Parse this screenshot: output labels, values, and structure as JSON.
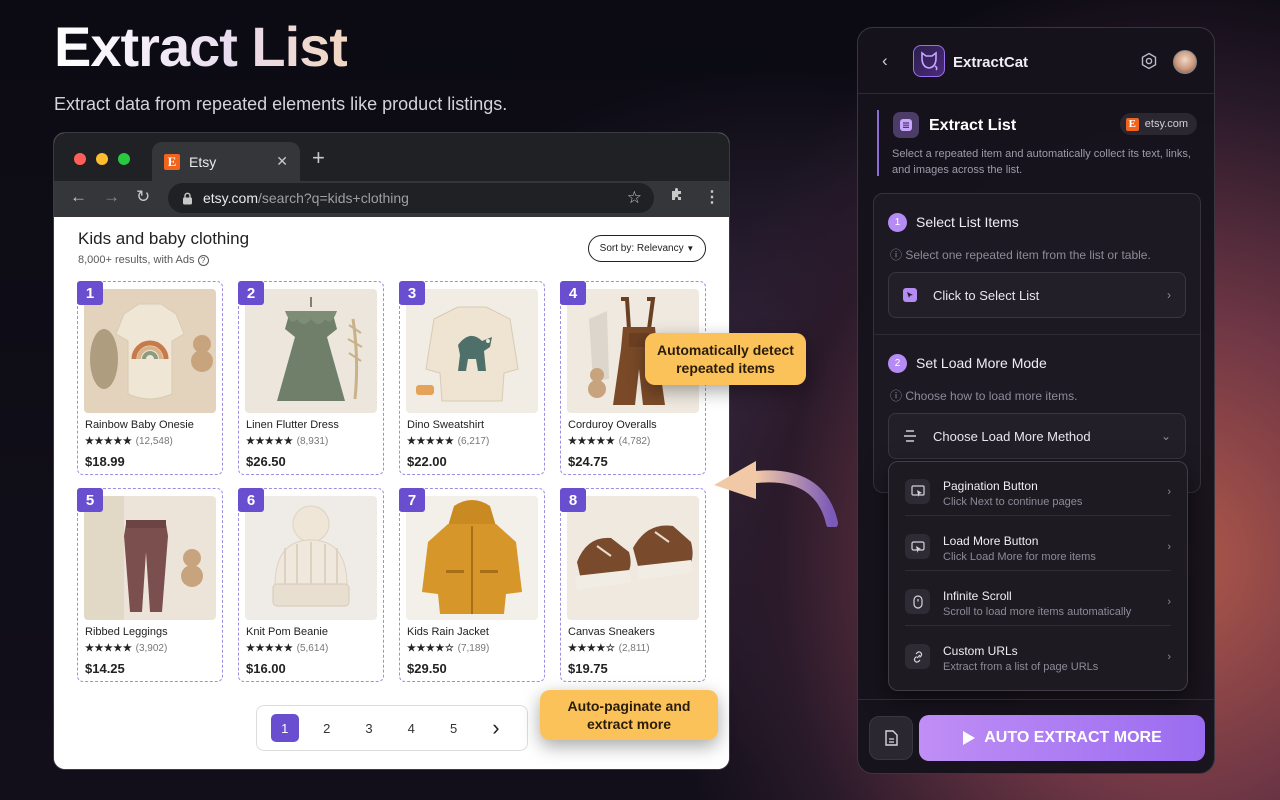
{
  "hero": {
    "title": "Extract List",
    "subtitle": "Extract data from repeated elements like product listings."
  },
  "browser": {
    "tab_title": "Etsy",
    "tab_close": "✕",
    "new_tab": "+",
    "url_domain": "etsy.com",
    "url_path": "/search?q=kids+clothing",
    "page_title": "Kids and baby clothing",
    "results": "8,000+ results, with Ads",
    "sort_label": "Sort by: Relevancy",
    "products": [
      {
        "badge": "1",
        "name": "Rainbow Baby Onesie",
        "stars": "★★★★★",
        "reviews": "(12,548)",
        "price": "$18.99"
      },
      {
        "badge": "2",
        "name": "Linen Flutter Dress",
        "stars": "★★★★★",
        "reviews": "(8,931)",
        "price": "$26.50"
      },
      {
        "badge": "3",
        "name": "Dino Sweatshirt",
        "stars": "★★★★★",
        "reviews": "(6,217)",
        "price": "$22.00"
      },
      {
        "badge": "4",
        "name": "Corduroy Overalls",
        "stars": "★★★★★",
        "reviews": "(4,782)",
        "price": "$24.75"
      },
      {
        "badge": "5",
        "name": "Ribbed Leggings",
        "stars": "★★★★★",
        "reviews": "(3,902)",
        "price": "$14.25"
      },
      {
        "badge": "6",
        "name": "Knit Pom Beanie",
        "stars": "★★★★★",
        "reviews": "(5,614)",
        "price": "$16.00"
      },
      {
        "badge": "7",
        "name": "Kids Rain Jacket",
        "stars": "★★★★☆",
        "reviews": "(7,189)",
        "price": "$29.50"
      },
      {
        "badge": "8",
        "name": "Canvas Sneakers",
        "stars": "★★★★☆",
        "reviews": "(2,811)",
        "price": "$19.75"
      }
    ],
    "pages": [
      "1",
      "2",
      "3",
      "4",
      "5"
    ],
    "next": "›"
  },
  "callouts": {
    "detect_line1": "Automatically detect",
    "detect_line2": "repeated items",
    "paginate_line1": "Auto-paginate and",
    "paginate_line2": "extract more"
  },
  "panel": {
    "brand": "ExtractCat",
    "section_title": "Extract List",
    "site": "etsy.com",
    "section_desc": "Select a repeated item and automatically collect its text, links, and images across the list.",
    "step1": {
      "num": "1",
      "title": "Select List Items",
      "hint": "ⓘ Select one repeated item from the list or table.",
      "button": "Click to Select List"
    },
    "step2": {
      "num": "2",
      "title": "Set Load More Mode",
      "hint": "ⓘ Choose how to load more items.",
      "button": "Choose Load More Method"
    },
    "options": [
      {
        "title": "Pagination Button",
        "desc": "Click Next to continue pages"
      },
      {
        "title": "Load More Button",
        "desc": "Click Load More for more items"
      },
      {
        "title": "Infinite Scroll",
        "desc": "Scroll to load more items automatically"
      },
      {
        "title": "Custom URLs",
        "desc": "Extract from a list of page URLs"
      }
    ],
    "cta": "AUTO EXTRACT MORE"
  },
  "colors": {
    "accent": "#9a6cf0",
    "badge": "#6a4ed0",
    "callout": "#fbc25a",
    "etsy": "#f1641e"
  }
}
